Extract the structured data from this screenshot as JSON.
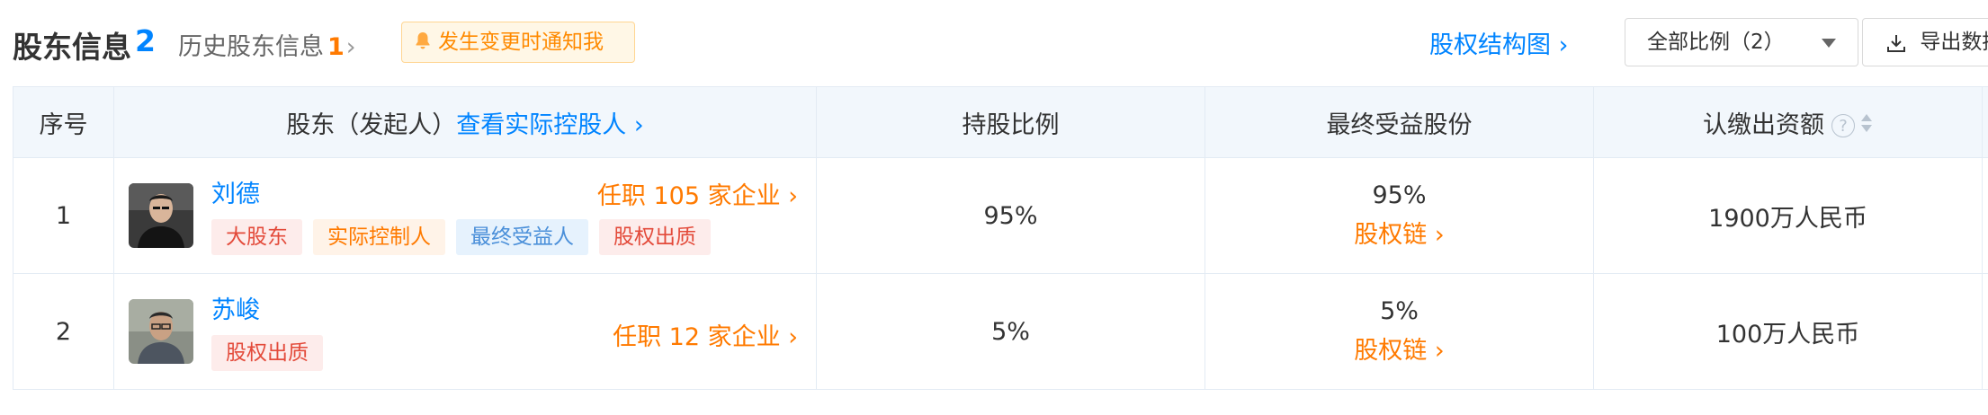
{
  "header": {
    "title": "股东信息",
    "count": "2",
    "history_label": "历史股东信息",
    "history_count": "1",
    "history_chevron": "›",
    "notify_label": "发生变更时通知我",
    "equity_chart_label": "股权结构图 ›",
    "ratio_select_value": "全部比例（2）",
    "export_label": "导出数据"
  },
  "table": {
    "columns": {
      "index": "序号",
      "holder": "股东（发起人）",
      "holder_link": "查看实际控股人 ›",
      "ratio": "持股比例",
      "benefit": "最终受益股份",
      "capital": "认缴出资额",
      "capital_help": "?"
    },
    "rows": [
      {
        "index": "1",
        "name": "刘德",
        "office": "任职 105 家企业 ›",
        "tags": [
          "大股东",
          "实际控制人",
          "最终受益人",
          "股权出质"
        ],
        "ratio": "95%",
        "benefit": "95%",
        "chain": "股权链 ›",
        "capital": "1900万人民币"
      },
      {
        "index": "2",
        "name": "苏峻",
        "office": "任职 12 家企业 ›",
        "tags": [
          "股权出质"
        ],
        "ratio": "5%",
        "benefit": "5%",
        "chain": "股权链 ›",
        "capital": "100万人民币"
      }
    ]
  },
  "colors": {
    "accent_blue": "#0084ff",
    "accent_orange": "#ff7a00",
    "tag_red": "#e34a3a",
    "tag_blue": "#4a8fd9",
    "header_bg": "#f2f7fc"
  }
}
